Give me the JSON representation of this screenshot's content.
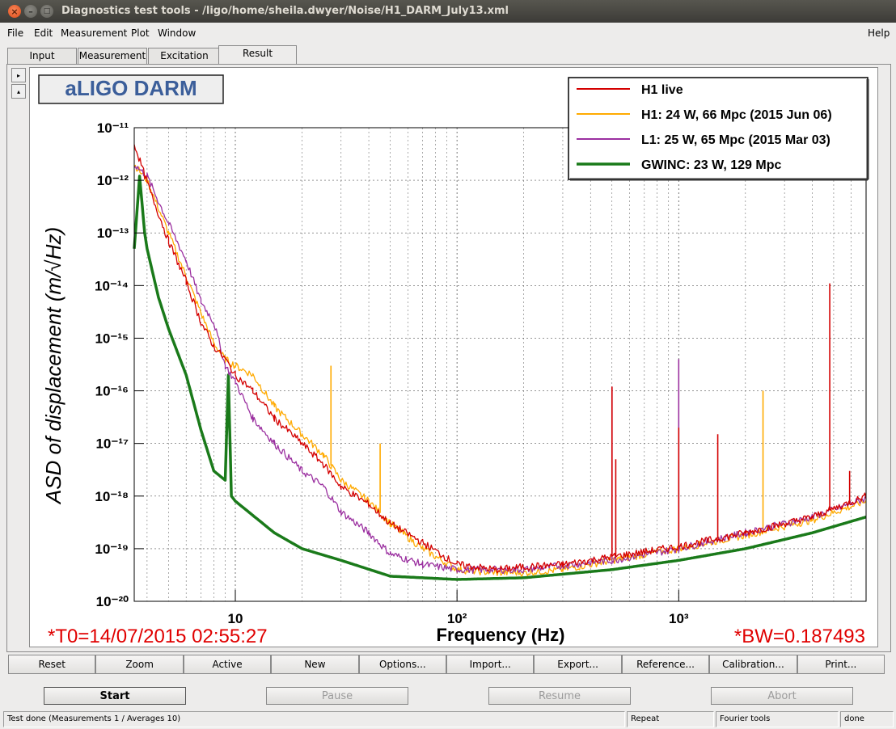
{
  "window": {
    "title": "Diagnostics test tools - /ligo/home/sheila.dwyer/Noise/H1_DARM_July13.xml"
  },
  "menu": {
    "file": "File",
    "edit": "Edit",
    "measurement": "Measurement",
    "plot": "Plot",
    "window": "Window",
    "help": "Help"
  },
  "tabs": {
    "input": "Input",
    "measurement": "Measurement",
    "excitation": "Excitation",
    "result": "Result"
  },
  "plot": {
    "title_box": "aLIGO DARM",
    "t0": "*T0=14/07/2015 02:55:27",
    "bw": "*BW=0.187493",
    "colors": {
      "h1_live": "#d40000",
      "h1_ref": "#ffaa00",
      "l1": "#9b30a0",
      "gwinc": "#1a7a1a",
      "annot": "#e00000",
      "title_box_text": "#3b5e9a"
    }
  },
  "chart_data": {
    "type": "line",
    "xlabel": "Frequency (Hz)",
    "ylabel": "ASD of displacement (m/√Hz)",
    "xscale": "log",
    "yscale": "log",
    "xlim": [
      3.5,
      7000
    ],
    "ylim": [
      1e-20,
      1e-11
    ],
    "grid": true,
    "legend_position": "top-right",
    "x_ticks": [
      "10",
      "10²",
      "10³"
    ],
    "y_ticks": [
      "10⁻¹¹",
      "10⁻¹²",
      "10⁻¹³",
      "10⁻¹⁴",
      "10⁻¹⁵",
      "10⁻¹⁶",
      "10⁻¹⁷",
      "10⁻¹⁸",
      "10⁻¹⁹",
      "10⁻²⁰"
    ],
    "series": [
      {
        "name": "H1 live",
        "color": "#d40000",
        "points": [
          [
            3.5,
            5e-12
          ],
          [
            4,
            9e-13
          ],
          [
            5,
            7e-14
          ],
          [
            6,
            1.2e-14
          ],
          [
            7,
            2e-15
          ],
          [
            8,
            7e-16
          ],
          [
            9,
            4e-16
          ],
          [
            10,
            2e-16
          ],
          [
            12,
            1e-16
          ],
          [
            15,
            3e-17
          ],
          [
            20,
            1e-17
          ],
          [
            25,
            4e-18
          ],
          [
            30,
            1.5e-18
          ],
          [
            40,
            7e-19
          ],
          [
            50,
            3e-19
          ],
          [
            70,
            1.3e-19
          ],
          [
            100,
            5e-20
          ],
          [
            150,
            4e-20
          ],
          [
            200,
            4.5e-20
          ],
          [
            300,
            5e-20
          ],
          [
            500,
            7e-20
          ],
          [
            1000,
            1.1e-19
          ],
          [
            2000,
            2e-19
          ],
          [
            4000,
            4e-19
          ],
          [
            7000,
            1e-18
          ]
        ],
        "spikes": [
          [
            500,
            1.2e-16
          ],
          [
            520,
            5e-18
          ],
          [
            1000,
            2e-17
          ],
          [
            1500,
            1.5e-17
          ],
          [
            4800,
            1.1e-14
          ],
          [
            5900,
            3e-18
          ]
        ]
      },
      {
        "name": "H1: 24 W, 66 Mpc (2015 Jun 06)",
        "color": "#ffaa00",
        "points": [
          [
            3.5,
            2e-12
          ],
          [
            4,
            1e-12
          ],
          [
            5,
            1e-13
          ],
          [
            6,
            1.5e-14
          ],
          [
            7,
            3e-15
          ],
          [
            8,
            8e-16
          ],
          [
            9,
            4e-16
          ],
          [
            10,
            3e-16
          ],
          [
            12,
            2e-16
          ],
          [
            15,
            5e-17
          ],
          [
            20,
            1.5e-17
          ],
          [
            25,
            6e-18
          ],
          [
            30,
            2e-18
          ],
          [
            40,
            8e-19
          ],
          [
            50,
            3e-19
          ],
          [
            70,
            1e-19
          ],
          [
            100,
            4e-20
          ],
          [
            150,
            3.5e-20
          ],
          [
            200,
            3.5e-20
          ],
          [
            300,
            4e-20
          ],
          [
            500,
            6e-20
          ],
          [
            1000,
            1e-19
          ],
          [
            2000,
            1.8e-19
          ],
          [
            4000,
            3.5e-19
          ],
          [
            7000,
            8e-19
          ]
        ],
        "spikes": [
          [
            27,
            3e-16
          ],
          [
            45,
            1e-17
          ],
          [
            2400,
            1e-16
          ]
        ]
      },
      {
        "name": "L1: 25 W, 65 Mpc (2015 Mar 03)",
        "color": "#9b30a0",
        "points": [
          [
            3.5,
            2e-12
          ],
          [
            4,
            1.2e-12
          ],
          [
            5,
            1.5e-13
          ],
          [
            6,
            3e-14
          ],
          [
            7,
            5e-15
          ],
          [
            8,
            2e-15
          ],
          [
            9,
            3e-16
          ],
          [
            10,
            1.5e-16
          ],
          [
            12,
            3e-17
          ],
          [
            15,
            1e-17
          ],
          [
            20,
            3e-18
          ],
          [
            25,
            1.5e-18
          ],
          [
            30,
            5e-19
          ],
          [
            40,
            2e-19
          ],
          [
            50,
            8e-20
          ],
          [
            70,
            5e-20
          ],
          [
            100,
            4e-20
          ],
          [
            200,
            4e-20
          ],
          [
            500,
            6e-20
          ],
          [
            1000,
            1e-19
          ],
          [
            2000,
            2e-19
          ],
          [
            4000,
            4e-19
          ],
          [
            7000,
            9e-19
          ]
        ],
        "spikes": [
          [
            500,
            1.2e-16
          ],
          [
            1000,
            4e-16
          ]
        ]
      },
      {
        "name": "GWINC: 23 W, 129 Mpc",
        "color": "#1a7a1a",
        "points": [
          [
            3.5,
            5e-14
          ],
          [
            3.7,
            1.2e-12
          ],
          [
            3.9,
            1e-13
          ],
          [
            4,
            5e-14
          ],
          [
            4.5,
            6e-15
          ],
          [
            5,
            1.5e-15
          ],
          [
            6,
            2e-16
          ],
          [
            7,
            1.8e-17
          ],
          [
            8,
            3e-18
          ],
          [
            9,
            2e-18
          ],
          [
            9.3,
            2e-16
          ],
          [
            9.6,
            1e-18
          ],
          [
            10,
            8e-19
          ],
          [
            15,
            2e-19
          ],
          [
            20,
            1e-19
          ],
          [
            30,
            6e-20
          ],
          [
            50,
            3e-20
          ],
          [
            100,
            2.6e-20
          ],
          [
            200,
            2.8e-20
          ],
          [
            500,
            4e-20
          ],
          [
            1000,
            6e-20
          ],
          [
            2000,
            1e-19
          ],
          [
            4000,
            2e-19
          ],
          [
            7000,
            4e-19
          ]
        ]
      }
    ]
  },
  "actions": {
    "reset": "Reset",
    "zoom": "Zoom",
    "active": "Active",
    "new": "New",
    "options": "Options...",
    "import": "Import...",
    "export": "Export...",
    "reference": "Reference...",
    "calibration": "Calibration...",
    "print": "Print..."
  },
  "control": {
    "start": "Start",
    "pause": "Pause",
    "resume": "Resume",
    "abort": "Abort"
  },
  "status": {
    "message": "Test done (Measurements 1 / Averages 10)",
    "repeat": "Repeat",
    "tool": "Fourier tools",
    "state": "done"
  }
}
